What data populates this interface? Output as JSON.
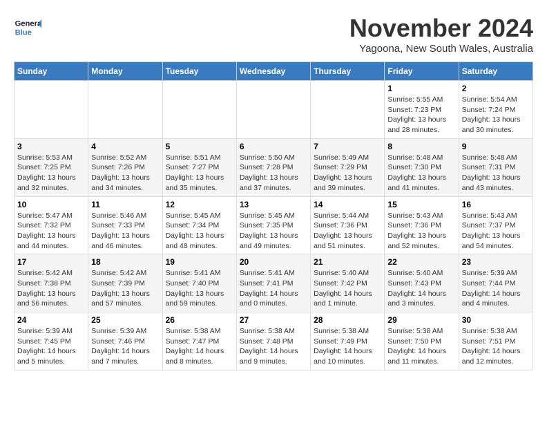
{
  "logo": {
    "text_general": "General",
    "text_blue": "Blue"
  },
  "header": {
    "month_year": "November 2024",
    "location": "Yagoona, New South Wales, Australia"
  },
  "weekdays": [
    "Sunday",
    "Monday",
    "Tuesday",
    "Wednesday",
    "Thursday",
    "Friday",
    "Saturday"
  ],
  "weeks": [
    [
      {
        "day": "",
        "info": ""
      },
      {
        "day": "",
        "info": ""
      },
      {
        "day": "",
        "info": ""
      },
      {
        "day": "",
        "info": ""
      },
      {
        "day": "",
        "info": ""
      },
      {
        "day": "1",
        "info": "Sunrise: 5:55 AM\nSunset: 7:23 PM\nDaylight: 13 hours and 28 minutes."
      },
      {
        "day": "2",
        "info": "Sunrise: 5:54 AM\nSunset: 7:24 PM\nDaylight: 13 hours and 30 minutes."
      }
    ],
    [
      {
        "day": "3",
        "info": "Sunrise: 5:53 AM\nSunset: 7:25 PM\nDaylight: 13 hours and 32 minutes."
      },
      {
        "day": "4",
        "info": "Sunrise: 5:52 AM\nSunset: 7:26 PM\nDaylight: 13 hours and 34 minutes."
      },
      {
        "day": "5",
        "info": "Sunrise: 5:51 AM\nSunset: 7:27 PM\nDaylight: 13 hours and 35 minutes."
      },
      {
        "day": "6",
        "info": "Sunrise: 5:50 AM\nSunset: 7:28 PM\nDaylight: 13 hours and 37 minutes."
      },
      {
        "day": "7",
        "info": "Sunrise: 5:49 AM\nSunset: 7:29 PM\nDaylight: 13 hours and 39 minutes."
      },
      {
        "day": "8",
        "info": "Sunrise: 5:48 AM\nSunset: 7:30 PM\nDaylight: 13 hours and 41 minutes."
      },
      {
        "day": "9",
        "info": "Sunrise: 5:48 AM\nSunset: 7:31 PM\nDaylight: 13 hours and 43 minutes."
      }
    ],
    [
      {
        "day": "10",
        "info": "Sunrise: 5:47 AM\nSunset: 7:32 PM\nDaylight: 13 hours and 44 minutes."
      },
      {
        "day": "11",
        "info": "Sunrise: 5:46 AM\nSunset: 7:33 PM\nDaylight: 13 hours and 46 minutes."
      },
      {
        "day": "12",
        "info": "Sunrise: 5:45 AM\nSunset: 7:34 PM\nDaylight: 13 hours and 48 minutes."
      },
      {
        "day": "13",
        "info": "Sunrise: 5:45 AM\nSunset: 7:35 PM\nDaylight: 13 hours and 49 minutes."
      },
      {
        "day": "14",
        "info": "Sunrise: 5:44 AM\nSunset: 7:36 PM\nDaylight: 13 hours and 51 minutes."
      },
      {
        "day": "15",
        "info": "Sunrise: 5:43 AM\nSunset: 7:36 PM\nDaylight: 13 hours and 52 minutes."
      },
      {
        "day": "16",
        "info": "Sunrise: 5:43 AM\nSunset: 7:37 PM\nDaylight: 13 hours and 54 minutes."
      }
    ],
    [
      {
        "day": "17",
        "info": "Sunrise: 5:42 AM\nSunset: 7:38 PM\nDaylight: 13 hours and 56 minutes."
      },
      {
        "day": "18",
        "info": "Sunrise: 5:42 AM\nSunset: 7:39 PM\nDaylight: 13 hours and 57 minutes."
      },
      {
        "day": "19",
        "info": "Sunrise: 5:41 AM\nSunset: 7:40 PM\nDaylight: 13 hours and 59 minutes."
      },
      {
        "day": "20",
        "info": "Sunrise: 5:41 AM\nSunset: 7:41 PM\nDaylight: 14 hours and 0 minutes."
      },
      {
        "day": "21",
        "info": "Sunrise: 5:40 AM\nSunset: 7:42 PM\nDaylight: 14 hours and 1 minute."
      },
      {
        "day": "22",
        "info": "Sunrise: 5:40 AM\nSunset: 7:43 PM\nDaylight: 14 hours and 3 minutes."
      },
      {
        "day": "23",
        "info": "Sunrise: 5:39 AM\nSunset: 7:44 PM\nDaylight: 14 hours and 4 minutes."
      }
    ],
    [
      {
        "day": "24",
        "info": "Sunrise: 5:39 AM\nSunset: 7:45 PM\nDaylight: 14 hours and 5 minutes."
      },
      {
        "day": "25",
        "info": "Sunrise: 5:39 AM\nSunset: 7:46 PM\nDaylight: 14 hours and 7 minutes."
      },
      {
        "day": "26",
        "info": "Sunrise: 5:38 AM\nSunset: 7:47 PM\nDaylight: 14 hours and 8 minutes."
      },
      {
        "day": "27",
        "info": "Sunrise: 5:38 AM\nSunset: 7:48 PM\nDaylight: 14 hours and 9 minutes."
      },
      {
        "day": "28",
        "info": "Sunrise: 5:38 AM\nSunset: 7:49 PM\nDaylight: 14 hours and 10 minutes."
      },
      {
        "day": "29",
        "info": "Sunrise: 5:38 AM\nSunset: 7:50 PM\nDaylight: 14 hours and 11 minutes."
      },
      {
        "day": "30",
        "info": "Sunrise: 5:38 AM\nSunset: 7:51 PM\nDaylight: 14 hours and 12 minutes."
      }
    ]
  ]
}
